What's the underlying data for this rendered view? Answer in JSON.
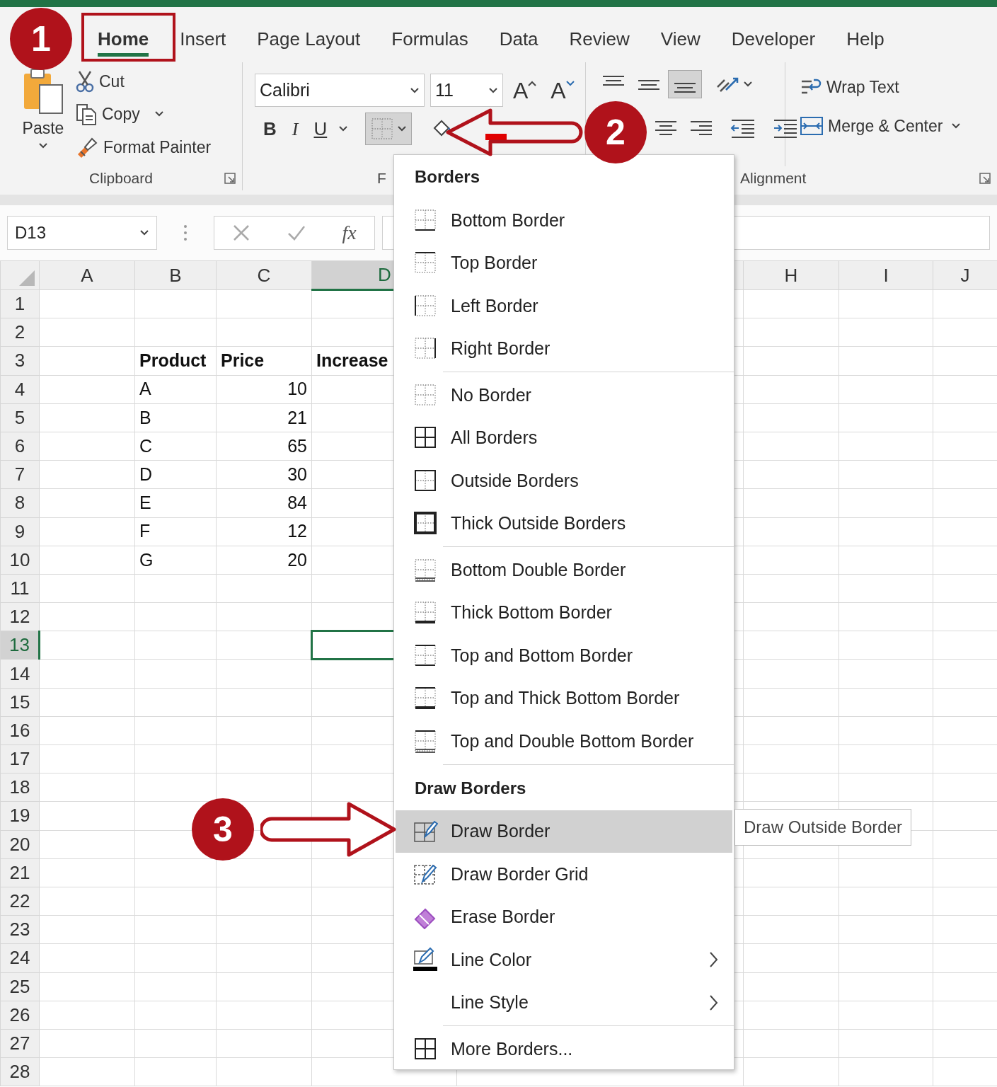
{
  "ribbon_tabs": [
    {
      "label": "Home",
      "selected": true
    },
    {
      "label": "Insert",
      "selected": false
    },
    {
      "label": "Page Layout",
      "selected": false
    },
    {
      "label": "Formulas",
      "selected": false
    },
    {
      "label": "Data",
      "selected": false
    },
    {
      "label": "Review",
      "selected": false
    },
    {
      "label": "View",
      "selected": false
    },
    {
      "label": "Developer",
      "selected": false
    },
    {
      "label": "Help",
      "selected": false
    }
  ],
  "clipboard": {
    "paste": "Paste",
    "cut": "Cut",
    "copy": "Copy",
    "format_painter": "Format Painter",
    "group_label": "Clipboard"
  },
  "font": {
    "name": "Calibri",
    "size": "11",
    "grow": "A",
    "shrink": "A",
    "bold": "B",
    "italic": "I",
    "underline": "U",
    "borders_pressed": true,
    "group_label": "F"
  },
  "alignment": {
    "bottom_align_selected": true,
    "wrap_text": "Wrap Text",
    "merge": "Merge & Center",
    "group_label": "Alignment"
  },
  "formula_bar": {
    "name_box": "D13",
    "function_label": "fx"
  },
  "columns": [
    {
      "label": "A",
      "selected": false
    },
    {
      "label": "B",
      "selected": false
    },
    {
      "label": "C",
      "selected": false
    },
    {
      "label": "D",
      "selected": true
    },
    {
      "label": "H",
      "selected": false
    },
    {
      "label": "I",
      "selected": false
    },
    {
      "label": "J",
      "selected": false
    }
  ],
  "rows": [
    {
      "label": "1",
      "selected": false
    },
    {
      "label": "2",
      "selected": false
    },
    {
      "label": "3",
      "selected": false,
      "bold": true,
      "cells": [
        null,
        {
          "text": "Product",
          "kind": "text"
        },
        {
          "text": "Price",
          "kind": "text"
        },
        {
          "text": "Increase",
          "kind": "text"
        }
      ]
    },
    {
      "label": "4",
      "selected": false,
      "bold": false,
      "cells": [
        null,
        {
          "text": "A",
          "kind": "text"
        },
        {
          "text": "10",
          "kind": "number"
        }
      ]
    },
    {
      "label": "5",
      "selected": false,
      "bold": false,
      "cells": [
        null,
        {
          "text": "B",
          "kind": "text"
        },
        {
          "text": "21",
          "kind": "number"
        }
      ]
    },
    {
      "label": "6",
      "selected": false,
      "bold": false,
      "cells": [
        null,
        {
          "text": "C",
          "kind": "text"
        },
        {
          "text": "65",
          "kind": "number"
        }
      ]
    },
    {
      "label": "7",
      "selected": false,
      "bold": false,
      "cells": [
        null,
        {
          "text": "D",
          "kind": "text"
        },
        {
          "text": "30",
          "kind": "number"
        }
      ]
    },
    {
      "label": "8",
      "selected": false,
      "bold": false,
      "cells": [
        null,
        {
          "text": "E",
          "kind": "text"
        },
        {
          "text": "84",
          "kind": "number"
        }
      ]
    },
    {
      "label": "9",
      "selected": false,
      "bold": false,
      "cells": [
        null,
        {
          "text": "F",
          "kind": "text"
        },
        {
          "text": "12",
          "kind": "number"
        }
      ]
    },
    {
      "label": "10",
      "selected": false,
      "bold": false,
      "cells": [
        null,
        {
          "text": "G",
          "kind": "text"
        },
        {
          "text": "20",
          "kind": "number"
        }
      ]
    },
    {
      "label": "11",
      "selected": false
    },
    {
      "label": "12",
      "selected": false
    },
    {
      "label": "13",
      "selected": true
    },
    {
      "label": "14",
      "selected": false
    },
    {
      "label": "15",
      "selected": false
    },
    {
      "label": "16",
      "selected": false
    },
    {
      "label": "17",
      "selected": false
    },
    {
      "label": "18",
      "selected": false
    },
    {
      "label": "19",
      "selected": false
    },
    {
      "label": "20",
      "selected": false
    },
    {
      "label": "21",
      "selected": false
    },
    {
      "label": "22",
      "selected": false
    },
    {
      "label": "23",
      "selected": false
    },
    {
      "label": "24",
      "selected": false
    },
    {
      "label": "25",
      "selected": false
    },
    {
      "label": "26",
      "selected": false
    },
    {
      "label": "27",
      "selected": false
    },
    {
      "label": "28",
      "selected": false
    }
  ],
  "borders_menu": [
    {
      "kind": "header",
      "label": "Borders"
    },
    {
      "kind": "item",
      "label": "Bottom Border",
      "selected": false
    },
    {
      "kind": "item",
      "label": "Top Border",
      "selected": false
    },
    {
      "kind": "item",
      "label": "Left Border",
      "selected": false
    },
    {
      "kind": "item",
      "label": "Right Border",
      "selected": false
    },
    {
      "kind": "separator"
    },
    {
      "kind": "item",
      "label": "No Border",
      "selected": false
    },
    {
      "kind": "item",
      "label": "All Borders",
      "selected": false
    },
    {
      "kind": "item",
      "label": "Outside Borders",
      "selected": false
    },
    {
      "kind": "item",
      "label": "Thick Outside Borders",
      "selected": false
    },
    {
      "kind": "separator"
    },
    {
      "kind": "item",
      "label": "Bottom Double Border",
      "selected": false
    },
    {
      "kind": "item",
      "label": "Thick Bottom Border",
      "selected": false
    },
    {
      "kind": "item",
      "label": "Top and Bottom Border",
      "selected": false
    },
    {
      "kind": "item",
      "label": "Top and Thick Bottom Border",
      "selected": false
    },
    {
      "kind": "item",
      "label": "Top and Double Bottom Border",
      "selected": false
    },
    {
      "kind": "separator"
    },
    {
      "kind": "header",
      "label": "Draw Borders"
    },
    {
      "kind": "item",
      "label": "Draw Border",
      "selected": true
    },
    {
      "kind": "item",
      "label": "Draw Border Grid",
      "selected": false
    },
    {
      "kind": "item",
      "label": "Erase Border",
      "selected": false
    },
    {
      "kind": "item",
      "label": "Line Color",
      "selected": false,
      "submenu": true
    },
    {
      "kind": "item",
      "label": "Line Style",
      "selected": false,
      "submenu": true
    },
    {
      "kind": "separator"
    },
    {
      "kind": "item",
      "label": "More Borders...",
      "selected": false
    }
  ],
  "tooltip": "Draw Outside Border",
  "callouts": [
    "1",
    "2",
    "3"
  ]
}
